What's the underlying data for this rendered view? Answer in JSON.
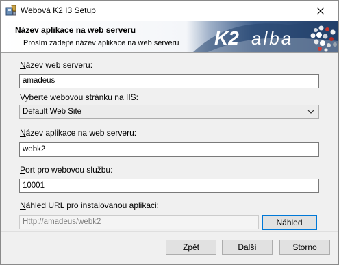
{
  "window": {
    "title": "Webová K2 I3 Setup"
  },
  "banner": {
    "title": "Název aplikace na web serveru",
    "subtitle": "Prosím zadejte název aplikace na web serveru",
    "logo_text_k2": "K2",
    "logo_text_alba": "alba"
  },
  "form": {
    "server_name_label_ul": "N",
    "server_name_label_rest": "ázev web serveru:",
    "server_name_value": "amadeus",
    "website_label": "Vyberte webovou stránku na IIS:",
    "website_selected": "Default Web Site",
    "app_name_label_ul": "N",
    "app_name_label_rest": "ázev aplikace na web serveru:",
    "app_name_value": "webk2",
    "port_label_ul": "P",
    "port_label_rest": "ort pro webovou službu:",
    "port_value": "10001",
    "url_label_ul": "N",
    "url_label_rest": "áhled URL pro instalovanou aplikaci:",
    "url_value": "Http://amadeus/webk2",
    "preview_button": "Náhled"
  },
  "footer": {
    "back_label": "Zpět",
    "next_label": "Další",
    "cancel_label": "Storno"
  },
  "colors": {
    "accent": "#0078d7",
    "banner_blue": "#2f4f7a"
  }
}
